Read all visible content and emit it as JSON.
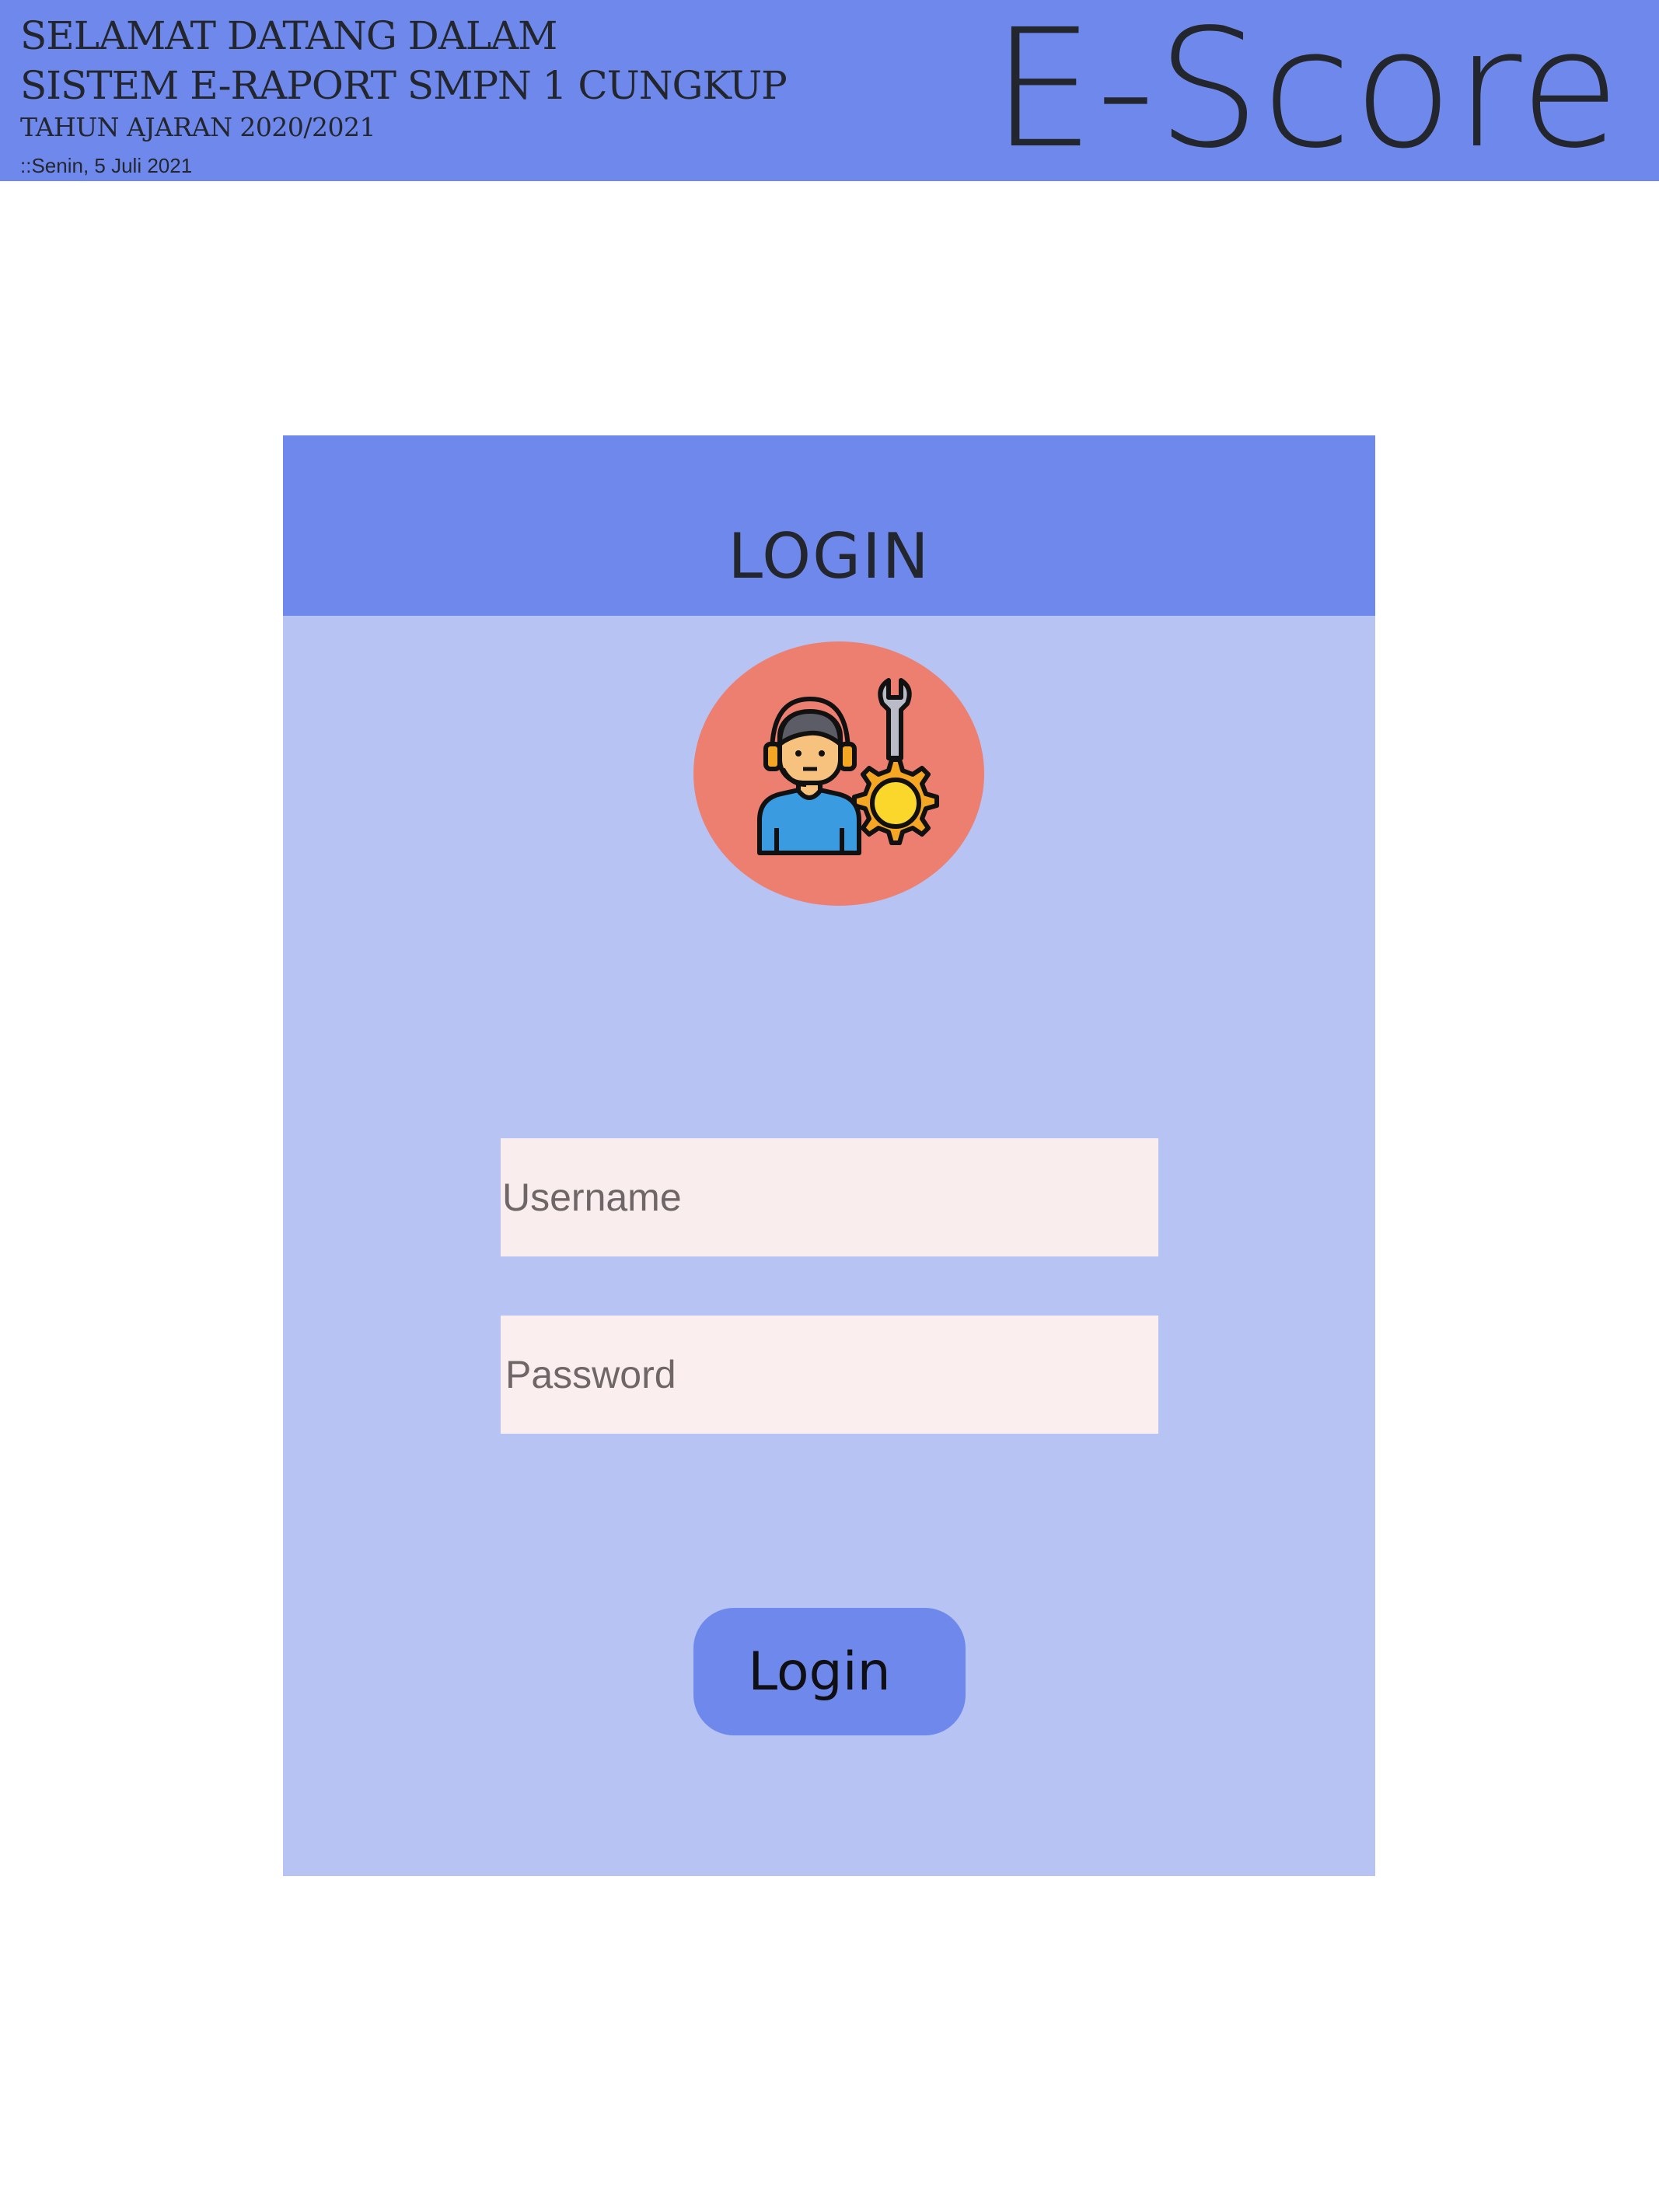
{
  "header": {
    "welcome_line1": "SELAMAT DATANG DALAM",
    "welcome_line2": "SISTEM E-RAPORT SMPN  1 CUNGKUP",
    "academic_year": "TAHUN AJARAN  2020/2021",
    "date": "::Senin, 5 Juli 2021",
    "brand": "E-Score",
    "background_color": "#6e89eb"
  },
  "login": {
    "title": "LOGIN",
    "avatar_icon": "technical-support-agent-icon",
    "username_placeholder": "Username",
    "password_placeholder": "Password",
    "button_label": "Login",
    "panel_color": "#b6c3f3",
    "accent_color": "#6e89eb",
    "avatar_color": "#ed7f70"
  }
}
